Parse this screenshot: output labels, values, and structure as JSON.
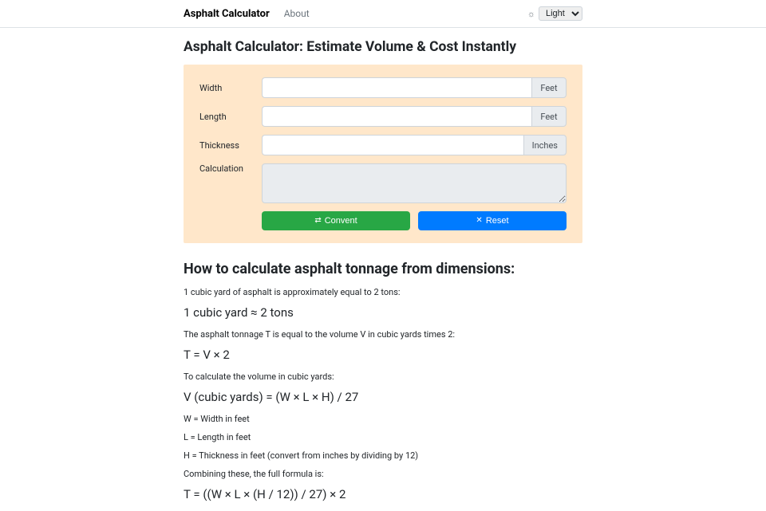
{
  "nav": {
    "brand": "Asphalt Calculator",
    "about": "About",
    "theme_selected": "Light"
  },
  "page": {
    "title": "Asphalt Calculator: Estimate Volume & Cost Instantly"
  },
  "form": {
    "width": {
      "label": "Width",
      "unit": "Feet",
      "value": ""
    },
    "length": {
      "label": "Length",
      "unit": "Feet",
      "value": ""
    },
    "thickness": {
      "label": "Thickness",
      "unit": "Inches",
      "value": ""
    },
    "calculation": {
      "label": "Calculation",
      "value": ""
    },
    "convert_btn": "Convent",
    "reset_btn": "Reset"
  },
  "explain": {
    "heading": "How to calculate asphalt tonnage from dimensions:",
    "p1": "1 cubic yard of asphalt is approximately equal to 2 tons:",
    "f1": "1 cubic yard ≈ 2 tons",
    "p2": "The asphalt tonnage T is equal to the volume V in cubic yards times 2:",
    "f2": "T = V × 2",
    "p3": "To calculate the volume in cubic yards:",
    "f3": "V (cubic yards) = (W × L × H) / 27",
    "p4": "W = Width in feet",
    "p5": "L = Length in feet",
    "p6": "H = Thickness in feet (convert from inches by dividing by 12)",
    "p7": "Combining these, the full formula is:",
    "f4": "T = ((W × L × (H / 12)) / 27) × 2"
  }
}
